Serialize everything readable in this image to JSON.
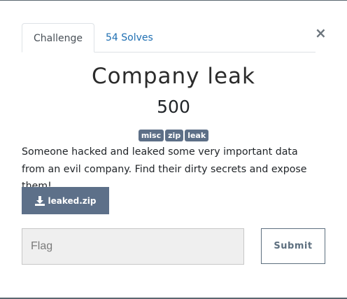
{
  "tabs": {
    "challenge_label": "Challenge",
    "solves_label": "54 Solves"
  },
  "close_glyph": "×",
  "challenge": {
    "name": "Company leak",
    "value": "500",
    "tags": [
      "misc",
      "zip",
      "leak"
    ],
    "description": "Someone hacked and leaked some very important data from an evil company. Find their dirty secrets and expose them!"
  },
  "download": {
    "icon": "download-icon",
    "label": "leaked.zip"
  },
  "flag_form": {
    "placeholder": "Flag",
    "value": "",
    "submit_label": "Submit"
  },
  "colors": {
    "tag_bg": "#5d6f87",
    "button_bg": "#5d7089",
    "link": "#1f6fb2"
  }
}
